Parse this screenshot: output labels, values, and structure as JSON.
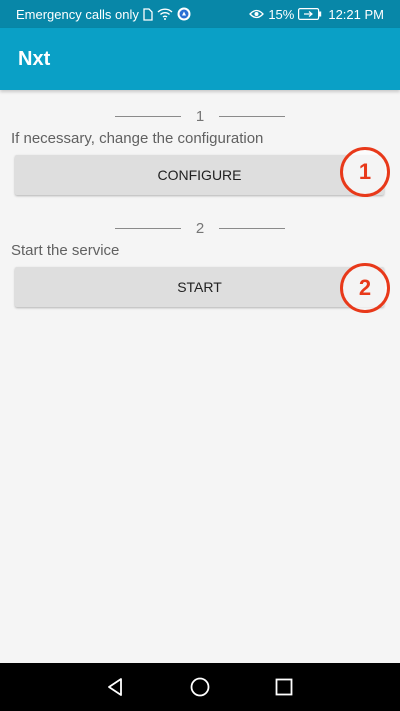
{
  "status_bar": {
    "carrier": "Emergency calls only",
    "battery": "15%",
    "time": "12:21 PM"
  },
  "app_bar": {
    "title": "Nxt"
  },
  "steps": [
    {
      "number": "1",
      "description": "If necessary, change the configuration",
      "button_label": "CONFIGURE",
      "callout": "1"
    },
    {
      "number": "2",
      "description": "Start the service",
      "button_label": "START",
      "callout": "2"
    }
  ],
  "colors": {
    "status_bar": "#0887a8",
    "app_bar": "#0aa0c6",
    "background": "#f5f5f5",
    "button": "#dedede",
    "callout": "#e8391a",
    "nav_bar": "#000000"
  },
  "icons": [
    "sim-icon",
    "wifi-icon",
    "app-notification-icon",
    "eye-comfort-icon",
    "battery-icon",
    "back-icon",
    "home-icon",
    "recents-icon"
  ]
}
